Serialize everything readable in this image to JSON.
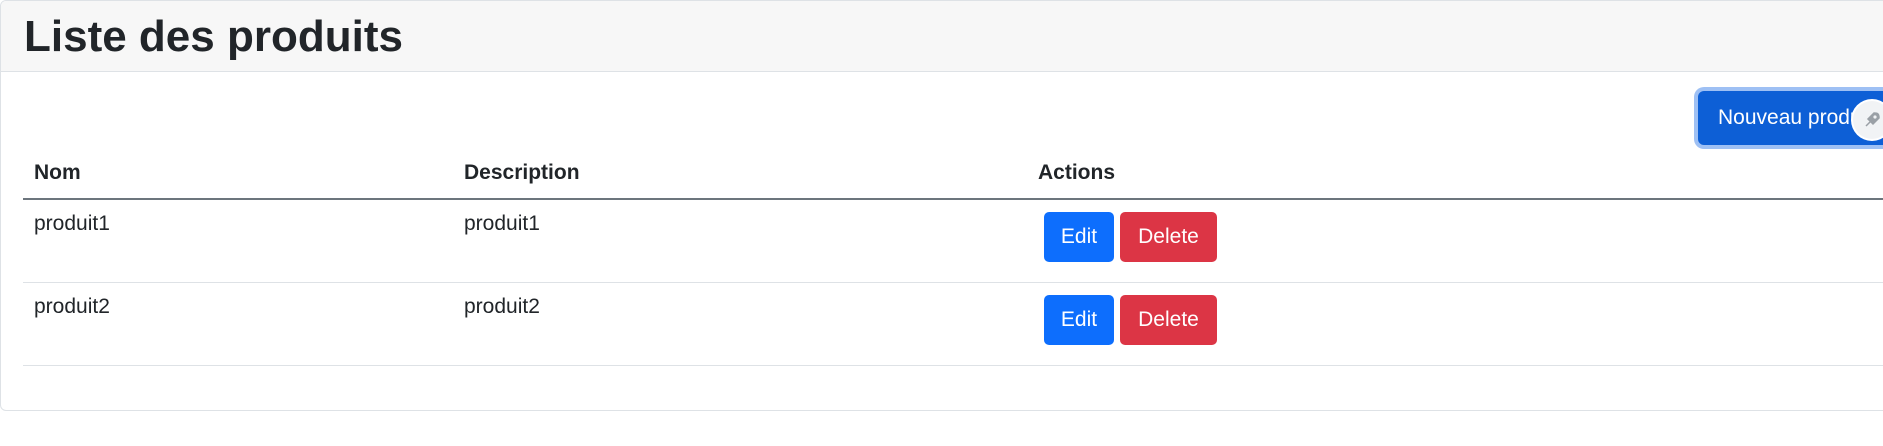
{
  "page": {
    "title": "Liste des produits",
    "new_button_label": "Nouveau produit"
  },
  "table": {
    "headers": [
      "Nom",
      "Description",
      "Actions"
    ],
    "rows": [
      {
        "nom": "produit1",
        "description": "produit1",
        "edit_label": "Edit",
        "delete_label": "Delete"
      },
      {
        "nom": "produit2",
        "description": "produit2",
        "edit_label": "Edit",
        "delete_label": "Delete"
      }
    ]
  },
  "colors": {
    "primary": "#0d6efd",
    "danger": "#dc3545",
    "header_bg": "#f7f7f7"
  },
  "icons": {
    "cursor_badge": "rocket-icon"
  }
}
